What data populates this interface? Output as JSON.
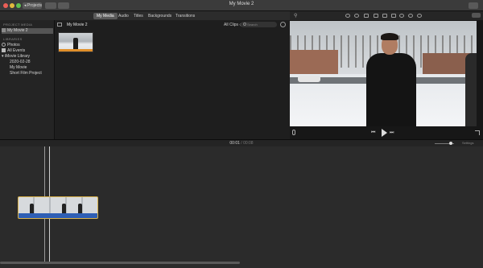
{
  "titlebar": {
    "back_label": "◂ Projects",
    "window_title": "My Movie 2",
    "colors": {
      "close": "#ec5f57",
      "minimize": "#e2b93d",
      "zoom": "#5fc24f"
    }
  },
  "media_tabs": [
    {
      "label": "My Media",
      "active": true
    },
    {
      "label": "Audio",
      "active": false
    },
    {
      "label": "Titles",
      "active": false
    },
    {
      "label": "Backgrounds",
      "active": false
    },
    {
      "label": "Transitions",
      "active": false
    }
  ],
  "sidebar": {
    "project_media_header": "PROJECT MEDIA",
    "project_item": "My Movie 2",
    "libraries_header": "LIBRARIES",
    "items": [
      {
        "label": "Photos",
        "icon": "photos-icon"
      },
      {
        "label": "All Events",
        "icon": "events-icon"
      },
      {
        "label": "▾ iMovie Library",
        "icon": "library-icon"
      },
      {
        "label": "2020-02-28",
        "icon": ""
      },
      {
        "label": "My Movie",
        "icon": ""
      },
      {
        "label": "Short Film Project",
        "icon": ""
      }
    ]
  },
  "browser": {
    "title": "My Movie 2",
    "filter_label": "All Clips ◇",
    "search_placeholder": "Search"
  },
  "timeline": {
    "timecode": "00:01",
    "duration": "/ 00:08",
    "settings_label": "Settings"
  }
}
